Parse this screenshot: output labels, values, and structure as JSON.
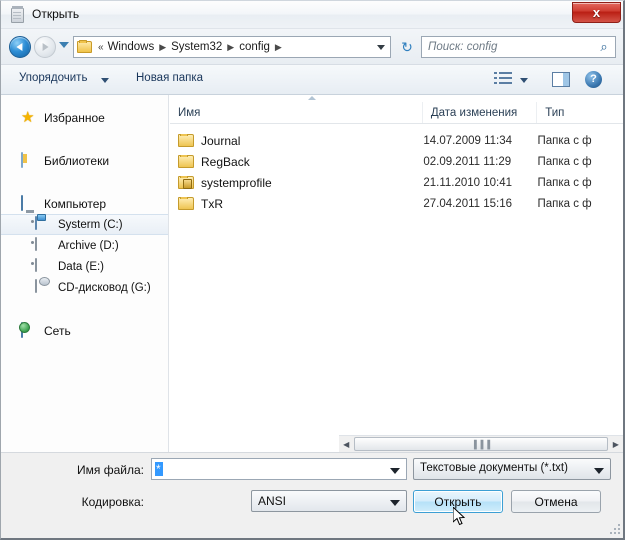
{
  "window": {
    "title": "Открыть",
    "title_icon": "notepad-icon",
    "close_label": "x",
    "accent_color": "#3399ff",
    "close_color": "#cf3d31"
  },
  "navbar": {
    "back_icon": "back-arrow-icon",
    "forward_icon": "forward-arrow-icon",
    "recent_icon": "chevron-down-icon",
    "folder_icon": "folder-icon",
    "overflow": "«",
    "breadcrumbs": [
      {
        "label": "Windows"
      },
      {
        "label": "System32"
      },
      {
        "label": "config"
      }
    ],
    "separator": "▶",
    "dropdown_icon": "chevron-down-icon",
    "refresh_icon": "refresh-icon",
    "refresh_glyph": "↻"
  },
  "search": {
    "placeholder": "Поиск: config",
    "value": "",
    "icon": "search-icon",
    "glyph": "⌕"
  },
  "toolbar": {
    "organize_label": "Упорядочить",
    "new_folder_label": "Новая папка",
    "views_icon": "view-list-icon",
    "preview_icon": "preview-pane-icon",
    "help_icon": "help-icon",
    "help_glyph": "?"
  },
  "sidebar": {
    "items": [
      {
        "label": "Избранное",
        "icon": "star-icon",
        "level": "group",
        "selected": false
      },
      {
        "label": "Библиотеки",
        "icon": "library-icon",
        "level": "group",
        "selected": false
      },
      {
        "label": "Компьютер",
        "icon": "computer-icon",
        "level": "group",
        "selected": false
      },
      {
        "label": "Systerm (C:)",
        "icon": "system-drive-icon",
        "level": "child",
        "selected": true
      },
      {
        "label": "Archive (D:)",
        "icon": "drive-icon",
        "level": "child",
        "selected": false
      },
      {
        "label": "Data (E:)",
        "icon": "drive-icon",
        "level": "child",
        "selected": false
      },
      {
        "label": "CD-дисковод (G:)",
        "icon": "cd-drive-icon",
        "level": "child",
        "selected": false
      },
      {
        "label": "Сеть",
        "icon": "network-icon",
        "level": "group",
        "selected": false
      }
    ]
  },
  "filelist": {
    "sort_indicator": "ascending",
    "columns": [
      {
        "label": "Имя",
        "key": "name"
      },
      {
        "label": "Дата изменения",
        "key": "date"
      },
      {
        "label": "Тип",
        "key": "type"
      }
    ],
    "rows": [
      {
        "name": "Journal",
        "date": "14.07.2009 11:34",
        "type": "Папка с ф",
        "icon": "folder-icon"
      },
      {
        "name": "RegBack",
        "date": "02.09.2011 11:29",
        "type": "Папка с ф",
        "icon": "folder-icon"
      },
      {
        "name": "systemprofile",
        "date": "21.11.2010 10:41",
        "type": "Папка с ф",
        "icon": "folder-locked-icon"
      },
      {
        "name": "TxR",
        "date": "27.04.2011 15:16",
        "type": "Папка с ф",
        "icon": "folder-icon"
      }
    ]
  },
  "hscrollbar": {
    "left_glyph": "◀",
    "right_glyph": "▶",
    "grip": "▐▐▐"
  },
  "footer": {
    "filename_label": "Имя файла:",
    "filename_value": "*",
    "encoding_label": "Кодировка:",
    "encoding_value": "ANSI",
    "filetype_value": "Текстовые документы (*.txt)",
    "open_label": "Открыть",
    "cancel_label": "Отмена"
  }
}
